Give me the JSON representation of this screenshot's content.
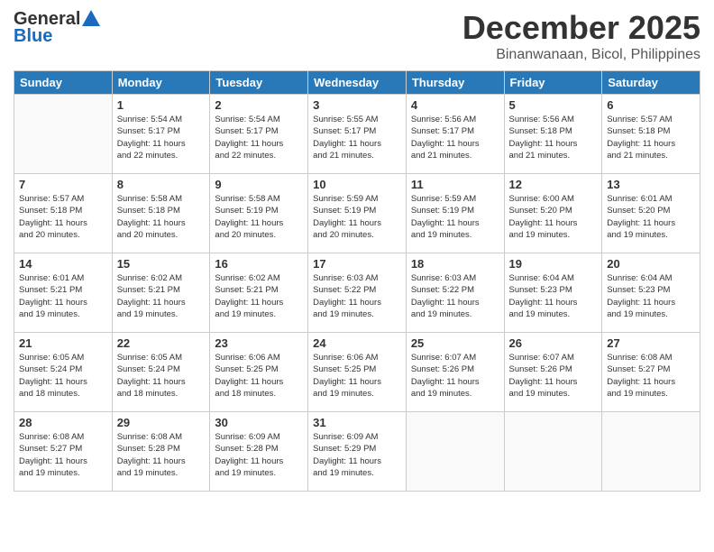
{
  "logo": {
    "general": "General",
    "blue": "Blue"
  },
  "header": {
    "month": "December 2025",
    "location": "Binanwanaan, Bicol, Philippines"
  },
  "days_of_week": [
    "Sunday",
    "Monday",
    "Tuesday",
    "Wednesday",
    "Thursday",
    "Friday",
    "Saturday"
  ],
  "weeks": [
    [
      {
        "day": "",
        "info": ""
      },
      {
        "day": "1",
        "info": "Sunrise: 5:54 AM\nSunset: 5:17 PM\nDaylight: 11 hours\nand 22 minutes."
      },
      {
        "day": "2",
        "info": "Sunrise: 5:54 AM\nSunset: 5:17 PM\nDaylight: 11 hours\nand 22 minutes."
      },
      {
        "day": "3",
        "info": "Sunrise: 5:55 AM\nSunset: 5:17 PM\nDaylight: 11 hours\nand 21 minutes."
      },
      {
        "day": "4",
        "info": "Sunrise: 5:56 AM\nSunset: 5:17 PM\nDaylight: 11 hours\nand 21 minutes."
      },
      {
        "day": "5",
        "info": "Sunrise: 5:56 AM\nSunset: 5:18 PM\nDaylight: 11 hours\nand 21 minutes."
      },
      {
        "day": "6",
        "info": "Sunrise: 5:57 AM\nSunset: 5:18 PM\nDaylight: 11 hours\nand 21 minutes."
      }
    ],
    [
      {
        "day": "7",
        "info": "Sunrise: 5:57 AM\nSunset: 5:18 PM\nDaylight: 11 hours\nand 20 minutes."
      },
      {
        "day": "8",
        "info": "Sunrise: 5:58 AM\nSunset: 5:18 PM\nDaylight: 11 hours\nand 20 minutes."
      },
      {
        "day": "9",
        "info": "Sunrise: 5:58 AM\nSunset: 5:19 PM\nDaylight: 11 hours\nand 20 minutes."
      },
      {
        "day": "10",
        "info": "Sunrise: 5:59 AM\nSunset: 5:19 PM\nDaylight: 11 hours\nand 20 minutes."
      },
      {
        "day": "11",
        "info": "Sunrise: 5:59 AM\nSunset: 5:19 PM\nDaylight: 11 hours\nand 19 minutes."
      },
      {
        "day": "12",
        "info": "Sunrise: 6:00 AM\nSunset: 5:20 PM\nDaylight: 11 hours\nand 19 minutes."
      },
      {
        "day": "13",
        "info": "Sunrise: 6:01 AM\nSunset: 5:20 PM\nDaylight: 11 hours\nand 19 minutes."
      }
    ],
    [
      {
        "day": "14",
        "info": "Sunrise: 6:01 AM\nSunset: 5:21 PM\nDaylight: 11 hours\nand 19 minutes."
      },
      {
        "day": "15",
        "info": "Sunrise: 6:02 AM\nSunset: 5:21 PM\nDaylight: 11 hours\nand 19 minutes."
      },
      {
        "day": "16",
        "info": "Sunrise: 6:02 AM\nSunset: 5:21 PM\nDaylight: 11 hours\nand 19 minutes."
      },
      {
        "day": "17",
        "info": "Sunrise: 6:03 AM\nSunset: 5:22 PM\nDaylight: 11 hours\nand 19 minutes."
      },
      {
        "day": "18",
        "info": "Sunrise: 6:03 AM\nSunset: 5:22 PM\nDaylight: 11 hours\nand 19 minutes."
      },
      {
        "day": "19",
        "info": "Sunrise: 6:04 AM\nSunset: 5:23 PM\nDaylight: 11 hours\nand 19 minutes."
      },
      {
        "day": "20",
        "info": "Sunrise: 6:04 AM\nSunset: 5:23 PM\nDaylight: 11 hours\nand 19 minutes."
      }
    ],
    [
      {
        "day": "21",
        "info": "Sunrise: 6:05 AM\nSunset: 5:24 PM\nDaylight: 11 hours\nand 18 minutes."
      },
      {
        "day": "22",
        "info": "Sunrise: 6:05 AM\nSunset: 5:24 PM\nDaylight: 11 hours\nand 18 minutes."
      },
      {
        "day": "23",
        "info": "Sunrise: 6:06 AM\nSunset: 5:25 PM\nDaylight: 11 hours\nand 18 minutes."
      },
      {
        "day": "24",
        "info": "Sunrise: 6:06 AM\nSunset: 5:25 PM\nDaylight: 11 hours\nand 19 minutes."
      },
      {
        "day": "25",
        "info": "Sunrise: 6:07 AM\nSunset: 5:26 PM\nDaylight: 11 hours\nand 19 minutes."
      },
      {
        "day": "26",
        "info": "Sunrise: 6:07 AM\nSunset: 5:26 PM\nDaylight: 11 hours\nand 19 minutes."
      },
      {
        "day": "27",
        "info": "Sunrise: 6:08 AM\nSunset: 5:27 PM\nDaylight: 11 hours\nand 19 minutes."
      }
    ],
    [
      {
        "day": "28",
        "info": "Sunrise: 6:08 AM\nSunset: 5:27 PM\nDaylight: 11 hours\nand 19 minutes."
      },
      {
        "day": "29",
        "info": "Sunrise: 6:08 AM\nSunset: 5:28 PM\nDaylight: 11 hours\nand 19 minutes."
      },
      {
        "day": "30",
        "info": "Sunrise: 6:09 AM\nSunset: 5:28 PM\nDaylight: 11 hours\nand 19 minutes."
      },
      {
        "day": "31",
        "info": "Sunrise: 6:09 AM\nSunset: 5:29 PM\nDaylight: 11 hours\nand 19 minutes."
      },
      {
        "day": "",
        "info": ""
      },
      {
        "day": "",
        "info": ""
      },
      {
        "day": "",
        "info": ""
      }
    ]
  ]
}
